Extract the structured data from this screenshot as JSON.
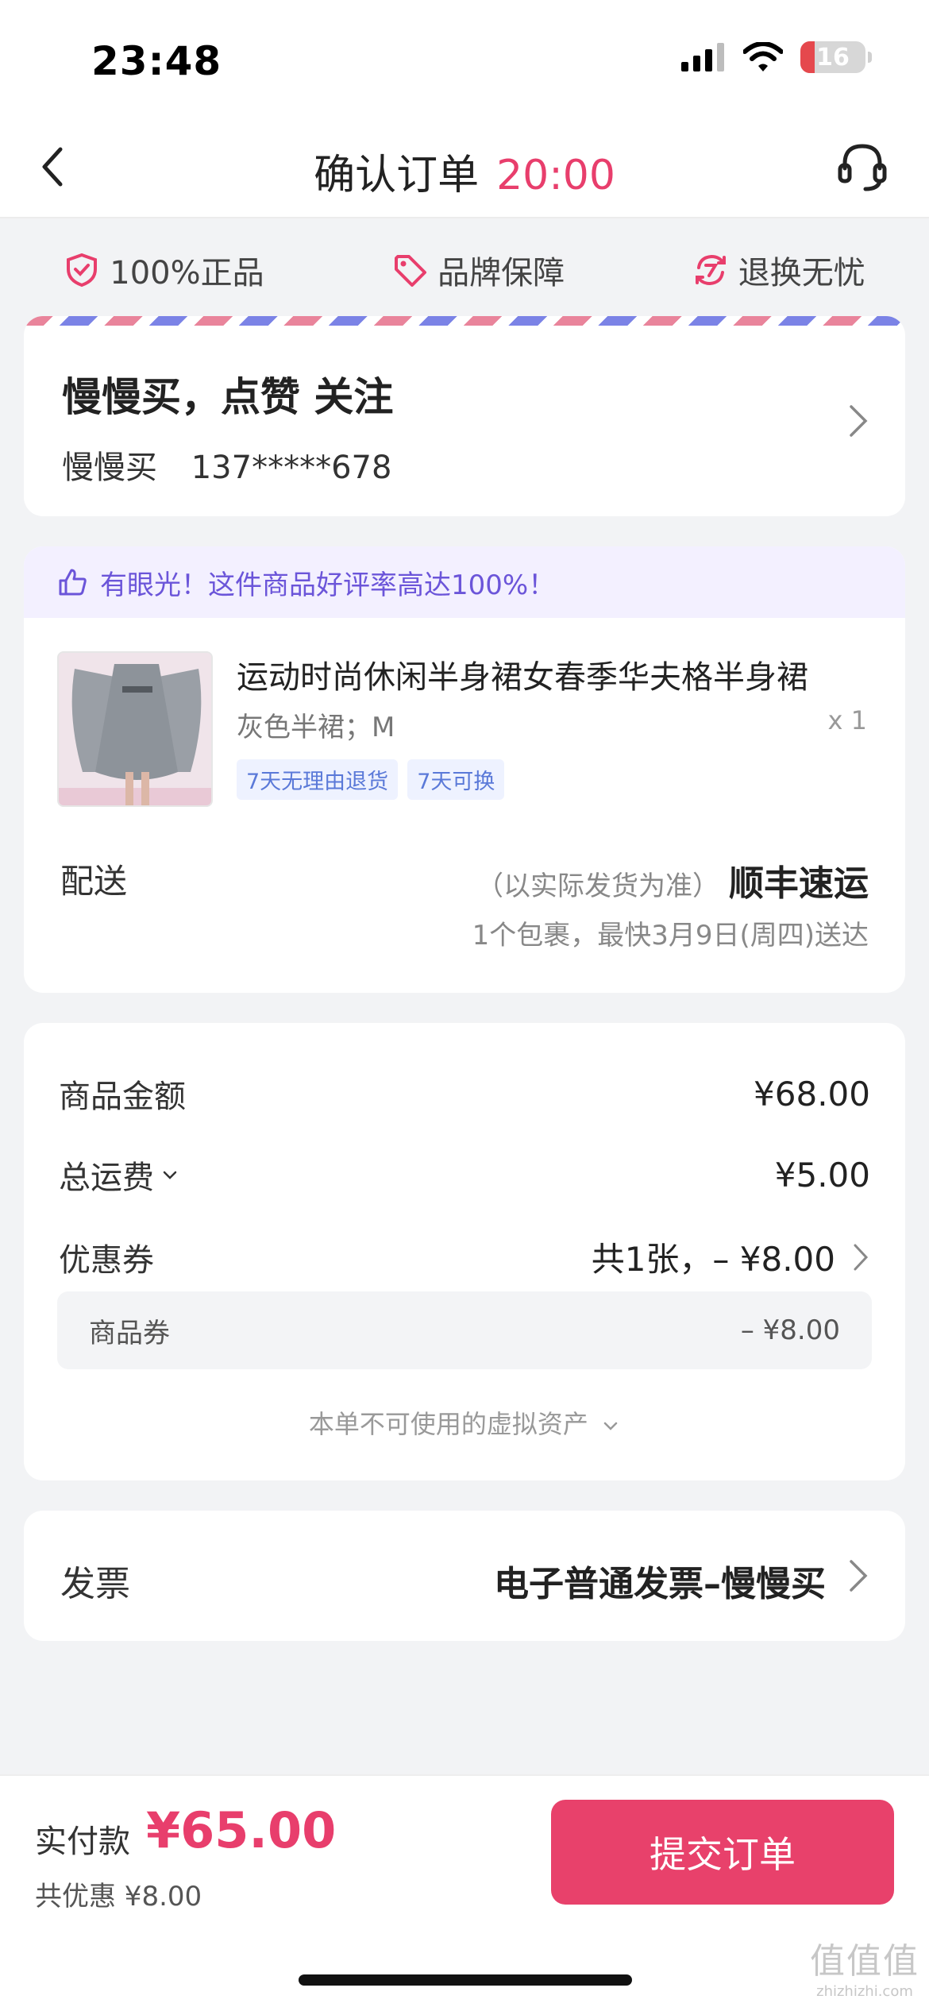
{
  "status_bar": {
    "time": "23:48",
    "battery": "16"
  },
  "nav": {
    "title": "确认订单",
    "timer": "20:00"
  },
  "guarantees": [
    {
      "icon": "shield-check-icon",
      "label": "100%正品"
    },
    {
      "icon": "price-tag-icon",
      "label": "品牌保障"
    },
    {
      "icon": "return-exchange-icon",
      "label": "退换无忧"
    }
  ],
  "address": {
    "name": "慢慢买，点赞 关注",
    "recipient": "慢慢买",
    "phone": "137*****678"
  },
  "product": {
    "rating_note": "有眼光！这件商品好评率高达100%！",
    "title": "运动时尚休闲半身裙女春季华夫格半身裙",
    "spec": "灰色半裙；M",
    "qty": "x 1",
    "tags": [
      "7天无理由退货",
      "7天可换"
    ],
    "shipping_label": "配送",
    "shipping_note": "（以实际发货为准）",
    "carrier": "顺丰速运",
    "eta": "1个包裹，最快3月9日(周四)送达"
  },
  "pricing": {
    "goods_label": "商品金额",
    "goods_value": "¥68.00",
    "freight_label": "总运费",
    "freight_value": "¥5.00",
    "coupon_label": "优惠券",
    "coupon_value": "共1张，– ¥8.00",
    "goods_coupon_label": "商品券",
    "goods_coupon_value": "– ¥8.00",
    "virtual_assets": "本单不可使用的虚拟资产"
  },
  "invoice": {
    "label": "发票",
    "value": "电子普通发票–慢慢买"
  },
  "footer": {
    "pay_label": "实付款",
    "pay_amount": "¥65.00",
    "discount": "共优惠 ¥8.00",
    "submit": "提交订单"
  },
  "watermark": {
    "logo": "值值值",
    "url": "zhizhizhi.com"
  },
  "colors": {
    "accent": "#e83e6c",
    "submit_bg": "#e8416b",
    "rating_text": "#6b55d9",
    "tag_text": "#5a79d8"
  }
}
